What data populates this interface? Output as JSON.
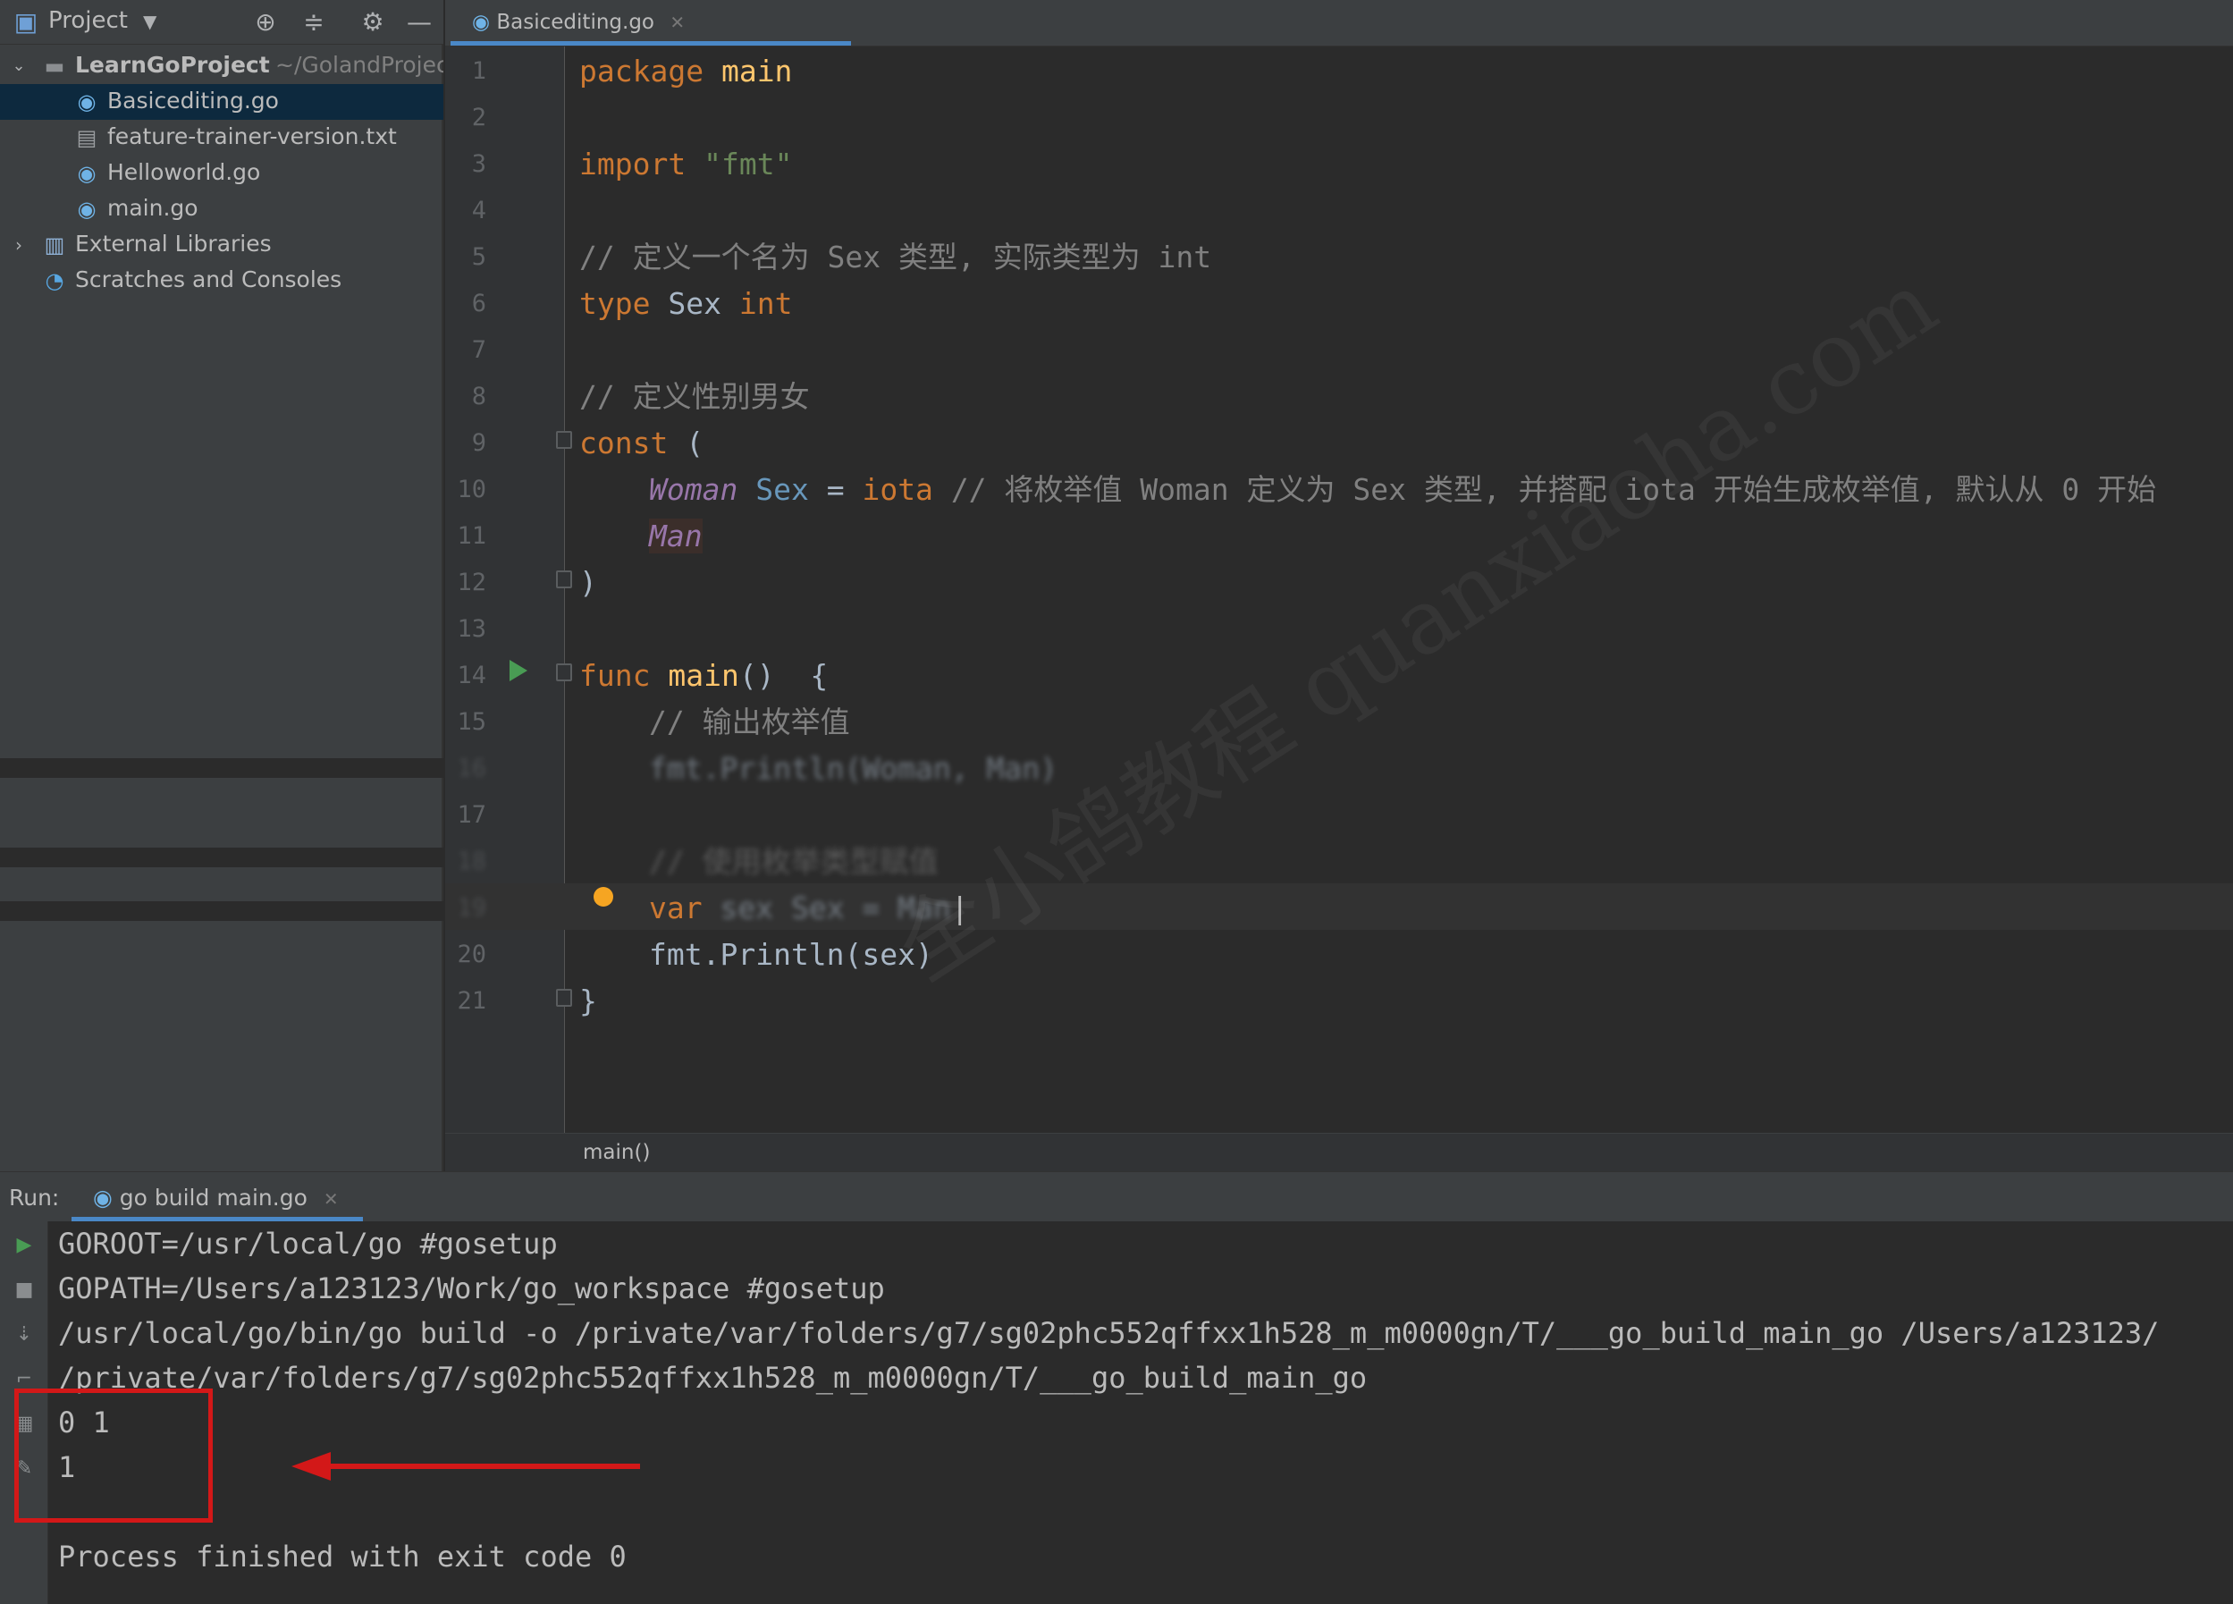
{
  "project_panel": {
    "title": "Project",
    "root": {
      "name": "LearnGoProject",
      "path": "~/GolandProjec"
    },
    "files": [
      "Basicediting.go",
      "feature-trainer-version.txt",
      "Helloworld.go",
      "main.go"
    ],
    "external": "External Libraries",
    "scratches": "Scratches and Consoles"
  },
  "editor": {
    "tab": "Basicediting.go",
    "breadcrumb": "main()",
    "line_numbers": [
      "1",
      "2",
      "3",
      "4",
      "5",
      "6",
      "7",
      "8",
      "9",
      "10",
      "11",
      "12",
      "13",
      "14",
      "15",
      "16",
      "17",
      "18",
      "19",
      "20",
      "21"
    ],
    "code": {
      "l1a": "package",
      "l1b": "main",
      "l3a": "import",
      "l3b": "\"fmt\"",
      "l5": "// 定义一个名为 Sex 类型, 实际类型为 int",
      "l6a": "type",
      "l6b": "Sex",
      "l6c": "int",
      "l8": "// 定义性别男女",
      "l9a": "const",
      "l9b": "(",
      "l10a": "Woman",
      "l10b": "Sex",
      "l10c": "=",
      "l10d": "iota",
      "l10e": "// 将枚举值 Woman 定义为 Sex 类型, 并搭配 iota 开始生成枚举值, 默认从 0 开始",
      "l11": "Man",
      "l12": ")",
      "l14a": "func",
      "l14b": "main",
      "l14c": "()  {",
      "l15": "// 输出枚举值",
      "l16": "fmt.Println(Woman, Man)",
      "l18": "// 使用枚举类型赋值",
      "l19a": "var",
      "l19b": "sex Sex = Man",
      "l20": "fmt.Println(sex)",
      "l21": "}"
    }
  },
  "watermark": "全小鸽教程 quanxiaoha.com",
  "run": {
    "label": "Run:",
    "tab": "go build main.go",
    "output": [
      "GOROOT=/usr/local/go #gosetup",
      "GOPATH=/Users/a123123/Work/go_workspace #gosetup",
      "/usr/local/go/bin/go build -o /private/var/folders/g7/sg02phc552qffxx1h528_m_m0000gn/T/___go_build_main_go /Users/a123123/",
      "/private/var/folders/g7/sg02phc552qffxx1h528_m_m0000gn/T/___go_build_main_go",
      "0 1",
      "1",
      "",
      "Process finished with exit code 0"
    ]
  },
  "colors": {
    "annotation_red": "#d31818",
    "accent_blue": "#4a88c7",
    "keyword": "#cc7832",
    "string": "#6a8759",
    "comment": "#808080"
  }
}
